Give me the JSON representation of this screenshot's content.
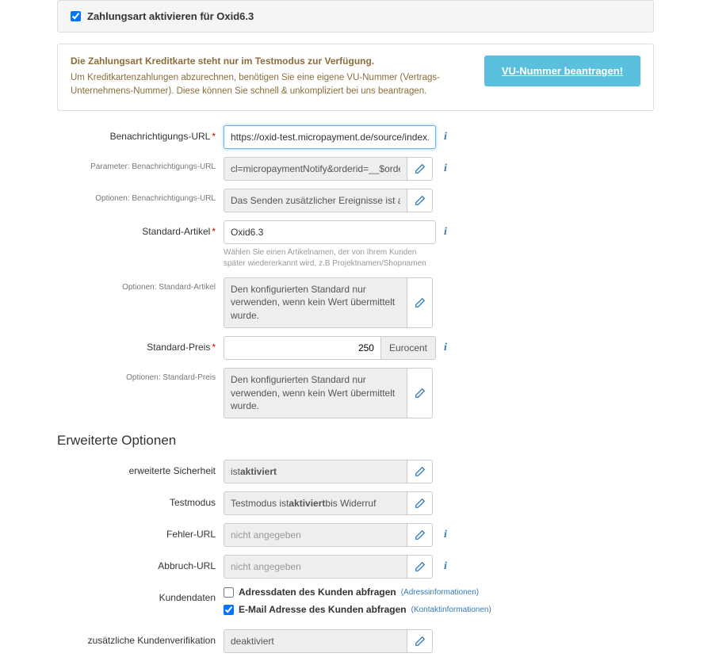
{
  "activate": {
    "label": "Zahlungsart aktivieren für Oxid6.3",
    "checked": true
  },
  "info": {
    "warn": "Die Zahlungsart Kreditkarte steht nur im Testmodus zur Verfügung.",
    "body": "Um Kreditkartenzahlungen abzurechnen, benötigen Sie eine eigene VU-Nummer (Vertrags-Unternehmens-Nummer). Diese können Sie schnell & unkompliziert bei uns beantragen.",
    "vu_btn": "VU-Nummer beantragen!"
  },
  "fields": {
    "notify_url": {
      "label": "Benachrichtigungs-URL",
      "value": "https://oxid-test.micropayment.de/source/index.php"
    },
    "notify_params": {
      "label": "Parameter: Benachrichtigungs-URL",
      "value": "cl=micropaymentNotify&orderid=__$orderid__&amou"
    },
    "notify_opts": {
      "label": "Optionen: Benachrichtigungs-URL",
      "value": "Das Senden zusätzlicher Ereignisse ist aktiviert"
    },
    "std_article": {
      "label": "Standard-Artikel",
      "value": "Oxid6.3",
      "hint": "Wählen Sie einen Artikelnamen, der von Ihrem Kunden später wiedererkannt wird, z.B Projektnamen/Shopnamen"
    },
    "std_article_opts": {
      "label": "Optionen: Standard-Artikel",
      "value": "Den konfigurierten Standard nur verwenden, wenn kein Wert übermittelt wurde."
    },
    "std_price": {
      "label": "Standard-Preis",
      "value": "250",
      "unit": "Eurocent"
    },
    "std_price_opts": {
      "label": "Optionen: Standard-Preis",
      "value": "Den konfigurierten Standard nur verwenden, wenn kein Wert übermittelt wurde."
    }
  },
  "advanced": {
    "heading": "Erweiterte Optionen",
    "ext_security": {
      "label": "erweiterte Sicherheit",
      "prefix": "ist ",
      "bold": "aktiviert"
    },
    "testmode": {
      "label": "Testmodus",
      "prefix": "Testmodus ist ",
      "bold": "aktiviert",
      "suffix": " bis Widerruf"
    },
    "error_url": {
      "label": "Fehler-URL",
      "placeholder": "nicht angegeben"
    },
    "abort_url": {
      "label": "Abbruch-URL",
      "placeholder": "nicht angegeben"
    },
    "customer_data": {
      "label": "Kundendaten",
      "cb1": {
        "checked": false,
        "text": "Adressdaten des Kunden abfragen",
        "link": "(Adressinformationen)"
      },
      "cb2": {
        "checked": true,
        "text": "E-Mail Adresse des Kunden abfragen",
        "link": "(Kontaktinformationen)"
      }
    },
    "extra_verify": {
      "label": "zusätzliche Kundenverifikation",
      "value": "deaktiviert"
    }
  },
  "icons": {
    "pencil": "pencil-icon",
    "info": "i"
  }
}
